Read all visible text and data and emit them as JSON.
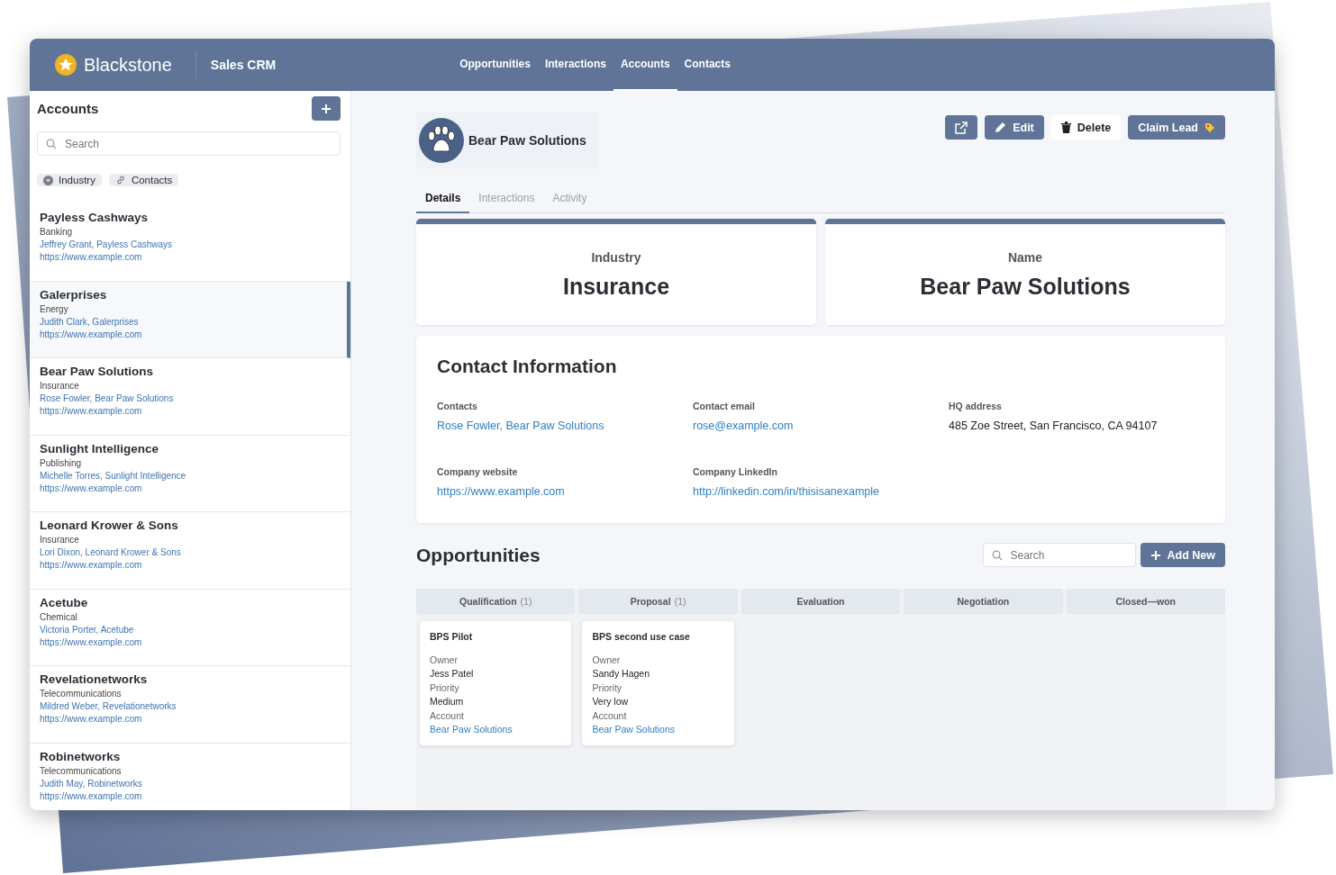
{
  "brand": {
    "name": "Blackstone",
    "app": "Sales CRM"
  },
  "nav": [
    {
      "label": "Opportunities",
      "selected": false
    },
    {
      "label": "Interactions",
      "selected": false
    },
    {
      "label": "Accounts",
      "selected": true
    },
    {
      "label": "Contacts",
      "selected": false
    }
  ],
  "sidebar": {
    "title": "Accounts",
    "search": {
      "placeholder": "Search"
    },
    "filters": [
      {
        "label": "Industry",
        "kind": "dropdown"
      },
      {
        "label": "Contacts",
        "kind": "link"
      }
    ],
    "items": [
      {
        "name": "Payless Cashways",
        "industry": "Banking",
        "contact": "Jeffrey Grant, Payless Cashways",
        "url": "https://www.example.com",
        "selected": false
      },
      {
        "name": "Galerprises",
        "industry": "Energy",
        "contact": "Judith Clark, Galerprises",
        "url": "https://www.example.com",
        "selected": true
      },
      {
        "name": "Bear Paw Solutions",
        "industry": "Insurance",
        "contact": "Rose Fowler, Bear Paw Solutions",
        "url": "https://www.example.com",
        "selected": false
      },
      {
        "name": "Sunlight Intelligence",
        "industry": "Publishing",
        "contact": "Michelle Torres, Sunlight Intelligence",
        "url": "https://www.example.com",
        "selected": false
      },
      {
        "name": "Leonard Krower & Sons",
        "industry": "Insurance",
        "contact": "Lori Dixon, Leonard Krower & Sons",
        "url": "https://www.example.com",
        "selected": false
      },
      {
        "name": "Acetube",
        "industry": "Chemical",
        "contact": "Victoria Porter, Acetube",
        "url": "https://www.example.com",
        "selected": false
      },
      {
        "name": "Revelationetworks",
        "industry": "Telecommunications",
        "contact": "Mildred Weber, Revelationetworks",
        "url": "https://www.example.com",
        "selected": false
      },
      {
        "name": "Robinetworks",
        "industry": "Telecommunications",
        "contact": "Judith May, Robinetworks",
        "url": "https://www.example.com",
        "selected": false
      }
    ]
  },
  "account": {
    "name": "Bear Paw Solutions",
    "actions": [
      {
        "kind": "open"
      },
      {
        "kind": "edit",
        "label": "Edit"
      },
      {
        "kind": "delete",
        "label": "Delete"
      },
      {
        "kind": "claim",
        "label": "Claim Lead"
      }
    ],
    "tabs": [
      {
        "label": "Details",
        "selected": true
      },
      {
        "label": "Interactions",
        "selected": false
      },
      {
        "label": "Activity",
        "selected": false
      }
    ],
    "stats": [
      {
        "label": "Industry",
        "value": "Insurance"
      },
      {
        "label": "Name",
        "value": "Bear Paw Solutions"
      }
    ],
    "contact_info": {
      "title": "Contact Information",
      "fields": [
        {
          "label": "Contacts",
          "value": "Rose Fowler, Bear Paw Solutions",
          "link": true
        },
        {
          "label": "Contact email",
          "value": "rose@example.com",
          "link": true
        },
        {
          "label": "HQ address",
          "value": "485 Zoe Street, San Francisco, CA 94107",
          "link": false
        },
        {
          "label": "Company website",
          "value": "https://www.example.com",
          "link": true
        },
        {
          "label": "Company LinkedIn",
          "value": "http://linkedin.com/in/thisisanexample",
          "link": true
        }
      ]
    }
  },
  "opportunities": {
    "title": "Opportunities",
    "search": {
      "placeholder": "Search"
    },
    "add_button": "Add New",
    "columns": [
      {
        "name": "Qualification",
        "count": "(1)",
        "cards": [
          {
            "title": "BPS Pilot",
            "owner_label": "Owner",
            "owner": "Jess Patel",
            "priority_label": "Priority",
            "priority": "Medium",
            "account_label": "Account",
            "account": "Bear Paw Solutions"
          }
        ]
      },
      {
        "name": "Proposal",
        "count": "(1)",
        "cards": [
          {
            "title": "BPS second use case",
            "owner_label": "Owner",
            "owner": "Sandy Hagen",
            "priority_label": "Priority",
            "priority": "Very low",
            "account_label": "Account",
            "account": "Bear Paw Solutions"
          }
        ]
      },
      {
        "name": "Evaluation"
      },
      {
        "name": "Negotiation"
      },
      {
        "name": "Closed—won"
      }
    ]
  }
}
